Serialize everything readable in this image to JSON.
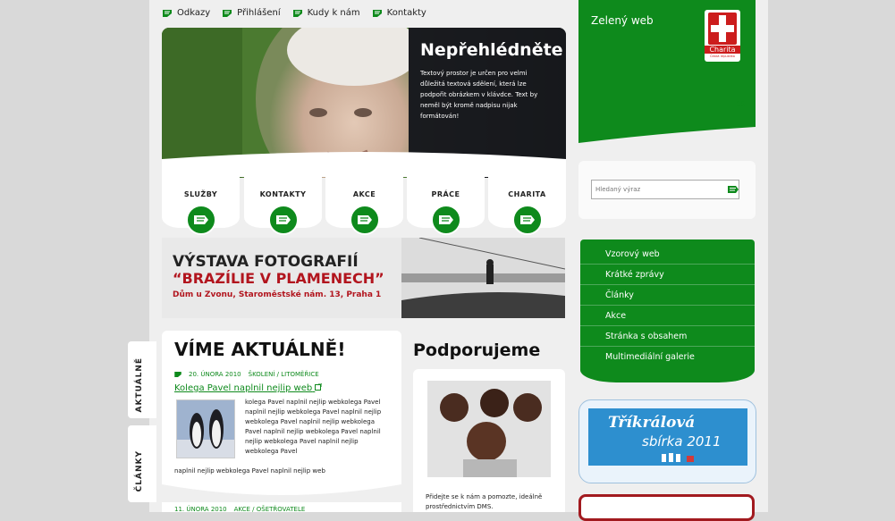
{
  "topnav": {
    "items": [
      {
        "label": "Odkazy"
      },
      {
        "label": "Přihlášení"
      },
      {
        "label": "Kudy k nám"
      },
      {
        "label": "Kontakty"
      }
    ]
  },
  "hero": {
    "title": "Nepřehlédněte",
    "text": "Textový prostor je určen pro velmi důležitá textová sdělení, která lze podpořit obrázkem v klávdce. Text by neměl být kromě nadpisu nijak formátován!"
  },
  "tiles": [
    {
      "label": "SLUŽBY"
    },
    {
      "label": "KONTAKTY"
    },
    {
      "label": "AKCE"
    },
    {
      "label": "PRÁCE"
    },
    {
      "label": "CHARITA"
    }
  ],
  "banner": {
    "line1": "VÝSTAVA FOTOGRAFIÍ",
    "line2": "“BRAZÍLIE V PLAMENECH”",
    "line3": "Dům u Zvonu, Staroměstské nám. 13, Praha 1"
  },
  "news": {
    "title": "VÍME AKTUÁLNĚ!",
    "item1": {
      "date": "20. ÚNORA 2010",
      "category": "ŠKOLENÍ / LITOMĚŘICE",
      "link": "Kolega Pavel naplnil nejlip web",
      "text": "kolega Pavel naplnil nejlip webkolega Pavel naplnil nejlip webkolega Pavel naplnil nejlip webkolega Pavel naplnil nejlip webkolega Pavel naplnil nejlip webkolega Pavel naplnil nejlip webkolega Pavel naplnil nejlip webkolega Pavel",
      "text2": "naplnil nejlip webkolega Pavel naplnil nejlip web"
    },
    "item2": {
      "date": "11. ÚNORA 2010",
      "category": "AKCE / OŠETŘOVATELE"
    }
  },
  "sidetabs": [
    {
      "label": "AKTUÁLNĚ"
    },
    {
      "label": "ČLÁNKY"
    }
  ],
  "support": {
    "title": "Podporujeme",
    "text": "Přidejte se k nám a pomozte, ideálně prostřednictvím DMS."
  },
  "right": {
    "site_name": "Zelený web",
    "logo_text": "Charita",
    "logo_sub": "Česká republika",
    "lang": "CS",
    "search_placeholder": "Hledaný výraz",
    "menu": [
      {
        "label": "Vzorový web"
      },
      {
        "label": "Krátké zprávy"
      },
      {
        "label": "Články"
      },
      {
        "label": "Akce"
      },
      {
        "label": "Stránka s obsahem"
      },
      {
        "label": "Multimediální galerie"
      }
    ],
    "trikralova_1": "Tříkrálová",
    "trikralova_2": "sbírka 2011"
  },
  "colors": {
    "brand_green": "#0e8a1c",
    "brand_red": "#b2151e"
  }
}
